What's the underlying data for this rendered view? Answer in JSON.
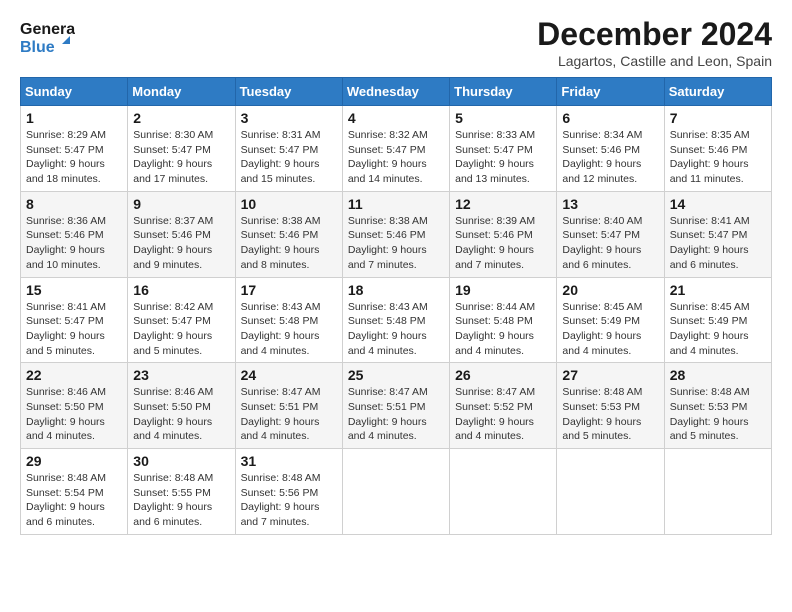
{
  "header": {
    "logo_line1": "General",
    "logo_line2": "Blue",
    "month_year": "December 2024",
    "location": "Lagartos, Castille and Leon, Spain"
  },
  "days_of_week": [
    "Sunday",
    "Monday",
    "Tuesday",
    "Wednesday",
    "Thursday",
    "Friday",
    "Saturday"
  ],
  "weeks": [
    [
      {
        "day": "1",
        "info": "Sunrise: 8:29 AM\nSunset: 5:47 PM\nDaylight: 9 hours and 18 minutes."
      },
      {
        "day": "2",
        "info": "Sunrise: 8:30 AM\nSunset: 5:47 PM\nDaylight: 9 hours and 17 minutes."
      },
      {
        "day": "3",
        "info": "Sunrise: 8:31 AM\nSunset: 5:47 PM\nDaylight: 9 hours and 15 minutes."
      },
      {
        "day": "4",
        "info": "Sunrise: 8:32 AM\nSunset: 5:47 PM\nDaylight: 9 hours and 14 minutes."
      },
      {
        "day": "5",
        "info": "Sunrise: 8:33 AM\nSunset: 5:47 PM\nDaylight: 9 hours and 13 minutes."
      },
      {
        "day": "6",
        "info": "Sunrise: 8:34 AM\nSunset: 5:46 PM\nDaylight: 9 hours and 12 minutes."
      },
      {
        "day": "7",
        "info": "Sunrise: 8:35 AM\nSunset: 5:46 PM\nDaylight: 9 hours and 11 minutes."
      }
    ],
    [
      {
        "day": "8",
        "info": "Sunrise: 8:36 AM\nSunset: 5:46 PM\nDaylight: 9 hours and 10 minutes."
      },
      {
        "day": "9",
        "info": "Sunrise: 8:37 AM\nSunset: 5:46 PM\nDaylight: 9 hours and 9 minutes."
      },
      {
        "day": "10",
        "info": "Sunrise: 8:38 AM\nSunset: 5:46 PM\nDaylight: 9 hours and 8 minutes."
      },
      {
        "day": "11",
        "info": "Sunrise: 8:38 AM\nSunset: 5:46 PM\nDaylight: 9 hours and 7 minutes."
      },
      {
        "day": "12",
        "info": "Sunrise: 8:39 AM\nSunset: 5:46 PM\nDaylight: 9 hours and 7 minutes."
      },
      {
        "day": "13",
        "info": "Sunrise: 8:40 AM\nSunset: 5:47 PM\nDaylight: 9 hours and 6 minutes."
      },
      {
        "day": "14",
        "info": "Sunrise: 8:41 AM\nSunset: 5:47 PM\nDaylight: 9 hours and 6 minutes."
      }
    ],
    [
      {
        "day": "15",
        "info": "Sunrise: 8:41 AM\nSunset: 5:47 PM\nDaylight: 9 hours and 5 minutes."
      },
      {
        "day": "16",
        "info": "Sunrise: 8:42 AM\nSunset: 5:47 PM\nDaylight: 9 hours and 5 minutes."
      },
      {
        "day": "17",
        "info": "Sunrise: 8:43 AM\nSunset: 5:48 PM\nDaylight: 9 hours and 4 minutes."
      },
      {
        "day": "18",
        "info": "Sunrise: 8:43 AM\nSunset: 5:48 PM\nDaylight: 9 hours and 4 minutes."
      },
      {
        "day": "19",
        "info": "Sunrise: 8:44 AM\nSunset: 5:48 PM\nDaylight: 9 hours and 4 minutes."
      },
      {
        "day": "20",
        "info": "Sunrise: 8:45 AM\nSunset: 5:49 PM\nDaylight: 9 hours and 4 minutes."
      },
      {
        "day": "21",
        "info": "Sunrise: 8:45 AM\nSunset: 5:49 PM\nDaylight: 9 hours and 4 minutes."
      }
    ],
    [
      {
        "day": "22",
        "info": "Sunrise: 8:46 AM\nSunset: 5:50 PM\nDaylight: 9 hours and 4 minutes."
      },
      {
        "day": "23",
        "info": "Sunrise: 8:46 AM\nSunset: 5:50 PM\nDaylight: 9 hours and 4 minutes."
      },
      {
        "day": "24",
        "info": "Sunrise: 8:47 AM\nSunset: 5:51 PM\nDaylight: 9 hours and 4 minutes."
      },
      {
        "day": "25",
        "info": "Sunrise: 8:47 AM\nSunset: 5:51 PM\nDaylight: 9 hours and 4 minutes."
      },
      {
        "day": "26",
        "info": "Sunrise: 8:47 AM\nSunset: 5:52 PM\nDaylight: 9 hours and 4 minutes."
      },
      {
        "day": "27",
        "info": "Sunrise: 8:48 AM\nSunset: 5:53 PM\nDaylight: 9 hours and 5 minutes."
      },
      {
        "day": "28",
        "info": "Sunrise: 8:48 AM\nSunset: 5:53 PM\nDaylight: 9 hours and 5 minutes."
      }
    ],
    [
      {
        "day": "29",
        "info": "Sunrise: 8:48 AM\nSunset: 5:54 PM\nDaylight: 9 hours and 6 minutes."
      },
      {
        "day": "30",
        "info": "Sunrise: 8:48 AM\nSunset: 5:55 PM\nDaylight: 9 hours and 6 minutes."
      },
      {
        "day": "31",
        "info": "Sunrise: 8:48 AM\nSunset: 5:56 PM\nDaylight: 9 hours and 7 minutes."
      },
      null,
      null,
      null,
      null
    ]
  ]
}
